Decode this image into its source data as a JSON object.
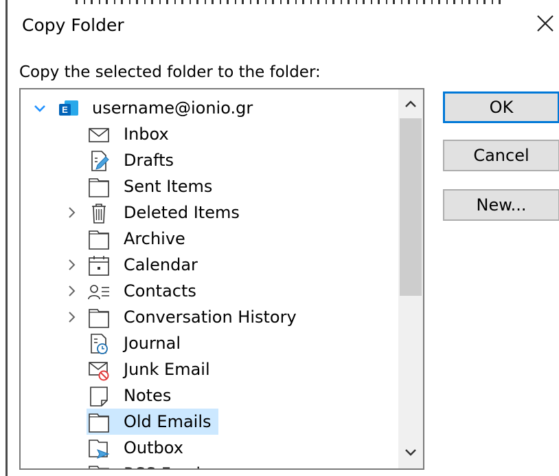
{
  "window": {
    "title": "Copy Folder"
  },
  "prompt": "Copy the selected folder to the folder:",
  "colors": {
    "accent": "#0078d7",
    "selection": "#cce8ff",
    "exchange_blue": "#0364b8"
  },
  "tree": {
    "items": [
      {
        "label": "username@ionio.gr",
        "icon": "exchange-account-icon",
        "expanded": true
      },
      {
        "label": "Inbox",
        "icon": "inbox-icon"
      },
      {
        "label": "Drafts",
        "icon": "drafts-icon"
      },
      {
        "label": "Sent Items",
        "icon": "folder-icon"
      },
      {
        "label": "Deleted Items",
        "icon": "trash-icon",
        "expandable": true
      },
      {
        "label": "Archive",
        "icon": "folder-icon"
      },
      {
        "label": "Calendar",
        "icon": "calendar-icon",
        "expandable": true
      },
      {
        "label": "Contacts",
        "icon": "contacts-icon",
        "expandable": true
      },
      {
        "label": "Conversation History",
        "icon": "folder-icon",
        "expandable": true
      },
      {
        "label": "Journal",
        "icon": "journal-icon"
      },
      {
        "label": "Junk Email",
        "icon": "junk-email-icon"
      },
      {
        "label": "Notes",
        "icon": "notes-icon"
      },
      {
        "label": "Old Emails",
        "icon": "folder-icon",
        "selected": true
      },
      {
        "label": "Outbox",
        "icon": "outbox-icon"
      },
      {
        "label": "RSS Feeds",
        "icon": "folder-icon"
      }
    ]
  },
  "buttons": {
    "ok": "OK",
    "cancel": "Cancel",
    "new": "New..."
  }
}
